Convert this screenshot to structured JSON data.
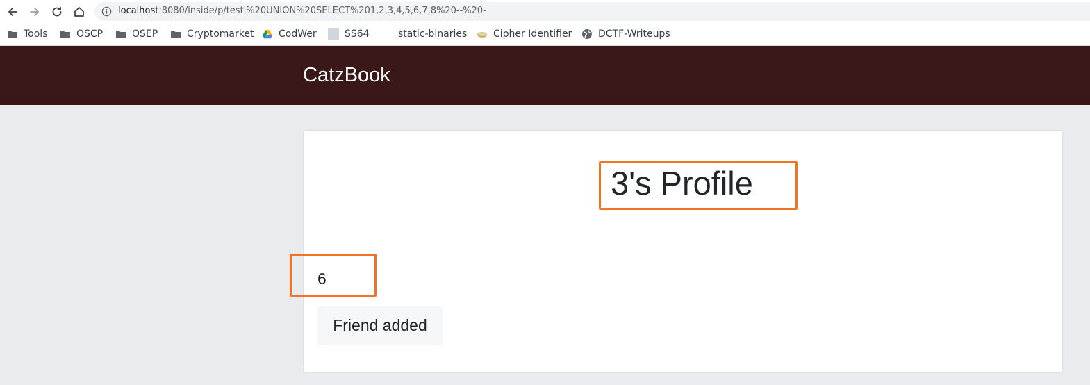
{
  "browser": {
    "url_host": "localhost",
    "url_rest": ":8080/inside/p/test'%20UNION%20SELECT%201,2,3,4,5,6,7,8%20--%20-",
    "bookmarks": [
      {
        "label": "Tools",
        "icon": "folder-icon"
      },
      {
        "label": "OSCP",
        "icon": "folder-icon"
      },
      {
        "label": "OSEP",
        "icon": "folder-icon"
      },
      {
        "label": "Cryptomarket",
        "icon": "folder-icon"
      },
      {
        "label": "CodWer",
        "icon": "google-drive-icon"
      },
      {
        "label": "SS64",
        "icon": "site-favicon-icon"
      },
      {
        "label": "static-binaries",
        "icon": "blank-favicon-icon"
      },
      {
        "label": "Cipher Identifier",
        "icon": "cipher-favicon-icon"
      },
      {
        "label": "DCTF-Writeups",
        "icon": "globe-icon"
      }
    ]
  },
  "site": {
    "brand": "CatzBook",
    "header_color": "#3b1818"
  },
  "profile": {
    "title": "3's Profile",
    "value": "6",
    "friend_status": "Friend added"
  },
  "annotation": {
    "highlight_color": "#f37321"
  }
}
